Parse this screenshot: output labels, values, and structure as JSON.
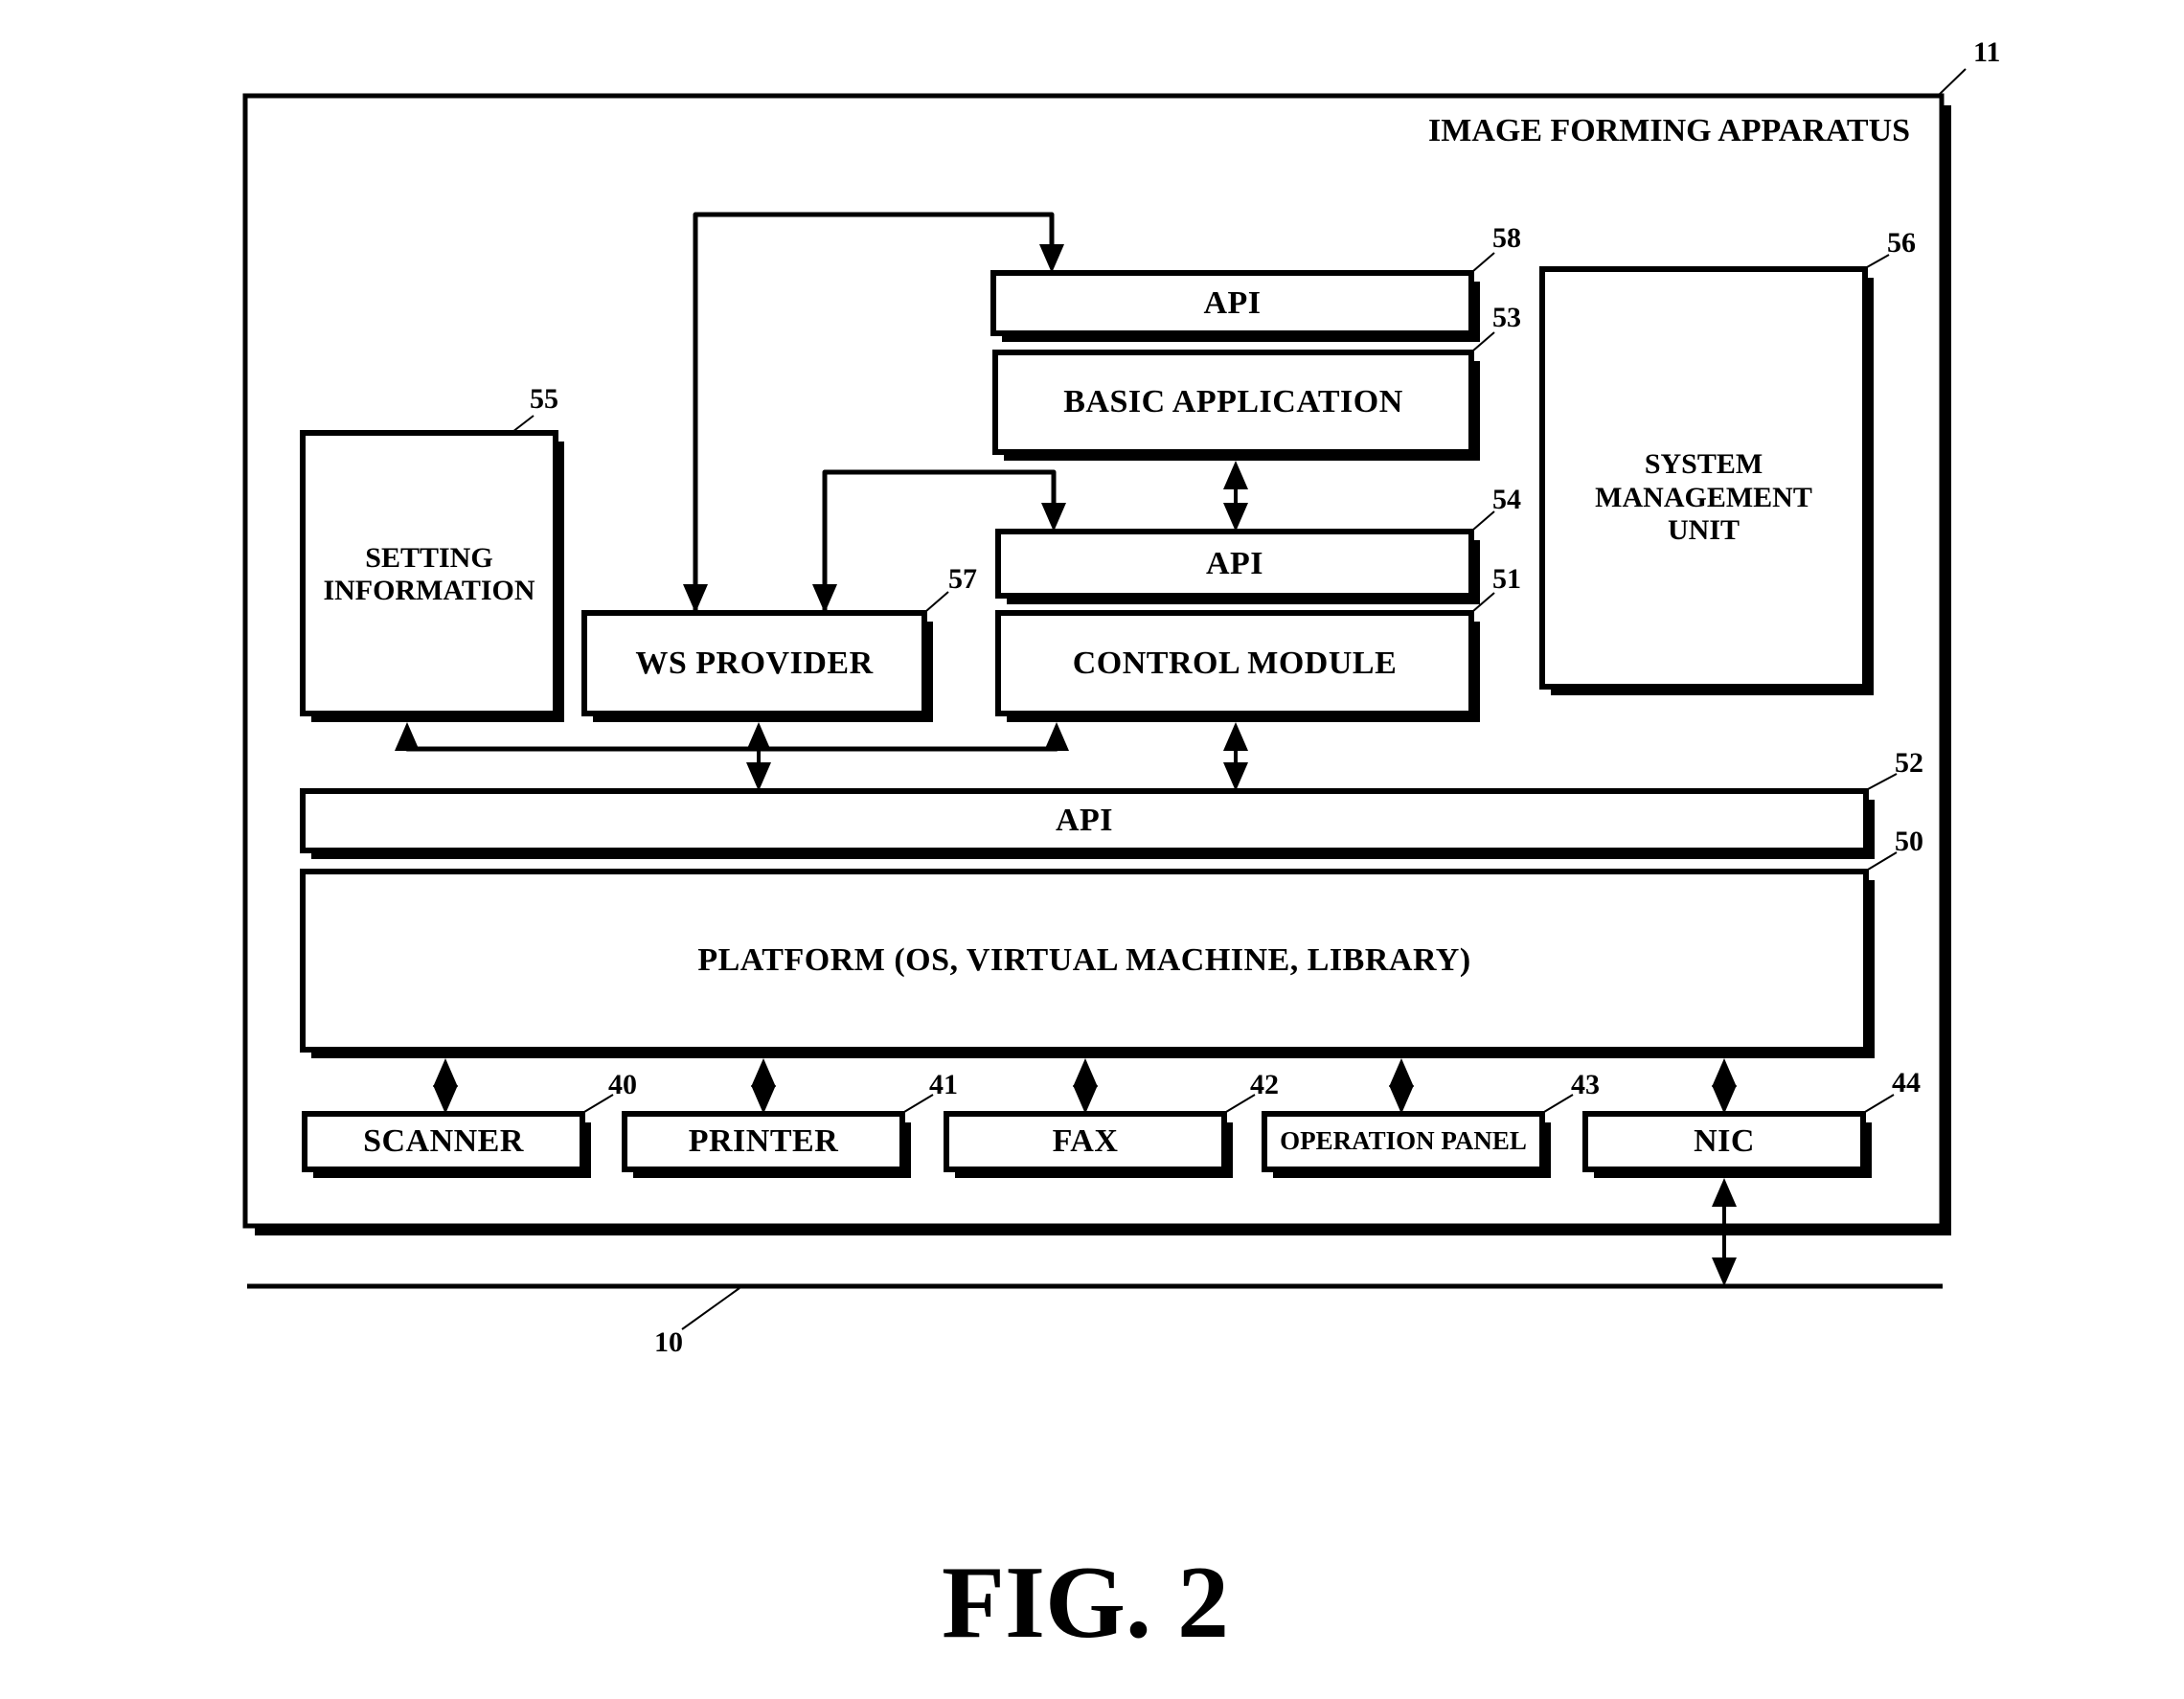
{
  "figure": {
    "caption": "FIG. 2",
    "apparatus": {
      "title": "IMAGE FORMING APPARATUS",
      "ref": "11"
    },
    "network": {
      "ref": "10"
    },
    "blocks": {
      "api_58": {
        "label": "API",
        "ref": "58"
      },
      "basic_application": {
        "label": "BASIC APPLICATION",
        "ref": "53"
      },
      "api_54": {
        "label": "API",
        "ref": "54"
      },
      "control_module": {
        "label": "CONTROL MODULE",
        "ref": "51"
      },
      "system_management_unit": {
        "label_lines": [
          "SYSTEM",
          "MANAGEMENT",
          "UNIT"
        ],
        "ref": "56"
      },
      "setting_information": {
        "label_lines": [
          "SETTING",
          "INFORMATION"
        ],
        "ref": "55"
      },
      "ws_provider": {
        "label": "WS PROVIDER",
        "ref": "57"
      },
      "api_52": {
        "label": "API",
        "ref": "52"
      },
      "platform": {
        "label": "PLATFORM (OS, VIRTUAL MACHINE, LIBRARY)",
        "ref": "50"
      },
      "scanner": {
        "label": "SCANNER",
        "ref": "40"
      },
      "printer": {
        "label": "PRINTER",
        "ref": "41"
      },
      "fax": {
        "label": "FAX",
        "ref": "42"
      },
      "operation_panel": {
        "label": "OPERATION PANEL",
        "ref": "43"
      },
      "nic": {
        "label": "NIC",
        "ref": "44"
      }
    },
    "connections": [
      {
        "from": "ws_provider",
        "to": "api_58",
        "type": "arrow"
      },
      {
        "from": "ws_provider",
        "to": "api_54",
        "type": "arrow"
      },
      {
        "from": "basic_application",
        "to": "api_54",
        "type": "bidirectional"
      },
      {
        "from": "api_52",
        "to": "setting_information",
        "type": "arrow"
      },
      {
        "from": "api_52",
        "to": "ws_provider",
        "type": "bidirectional"
      },
      {
        "from": "api_52",
        "to": "control_module",
        "type": "arrow"
      },
      {
        "from": "control_module",
        "to": "api_52",
        "type": "bidirectional"
      },
      {
        "from": "platform",
        "to": "scanner",
        "type": "bidirectional"
      },
      {
        "from": "platform",
        "to": "printer",
        "type": "bidirectional"
      },
      {
        "from": "platform",
        "to": "fax",
        "type": "bidirectional"
      },
      {
        "from": "platform",
        "to": "operation_panel",
        "type": "bidirectional"
      },
      {
        "from": "platform",
        "to": "nic",
        "type": "bidirectional"
      },
      {
        "from": "nic",
        "to": "network",
        "type": "bidirectional"
      }
    ]
  }
}
